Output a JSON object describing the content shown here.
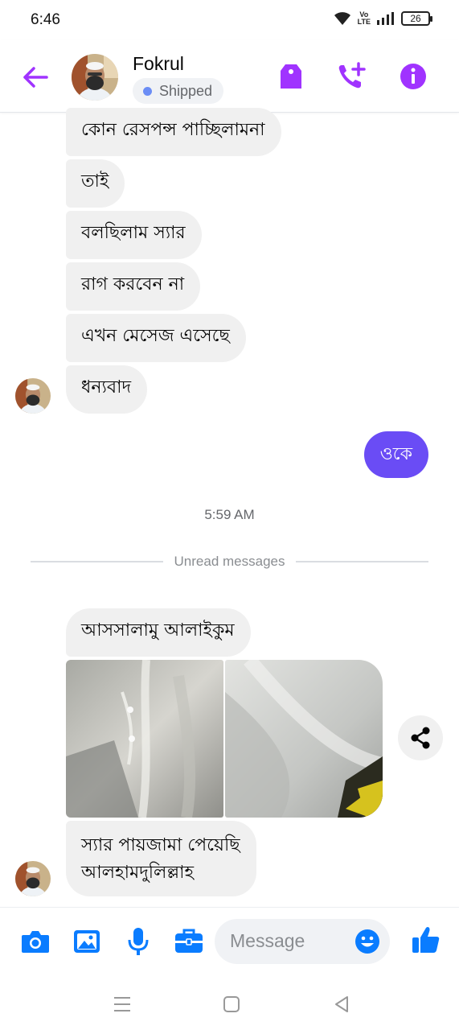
{
  "status_bar": {
    "time": "6:46",
    "volte_line1": "Vo",
    "volte_line2": "LTE",
    "battery": "26"
  },
  "header": {
    "name": "Fokrul",
    "label_chip": "Shipped",
    "accent_color": "#a033ff",
    "icons": [
      "back-arrow-icon",
      "label-tag-icon",
      "add-call-icon",
      "info-icon"
    ]
  },
  "messages": {
    "incoming_first": [
      "কোন রেসপন্স পাচ্ছিলামনা",
      "তাই",
      "বলছিলাম স্যার",
      "রাগ করবেন না",
      "এখন মেসেজ এসেছে",
      "ধন্যবাদ"
    ],
    "outgoing": "ওকে",
    "outgoing_color": "#6a4cf5",
    "timestamp": "5:59 AM",
    "unread_divider": "Unread messages",
    "incoming_second": [
      "আসসালামু আলাইকুম"
    ],
    "incoming_last_line1": "স্যার পায়জামা পেয়েছি",
    "incoming_last_line2": "আলহামদুলিল্লাহ"
  },
  "composer": {
    "placeholder": "Message",
    "accent_color": "#0a7cff",
    "icons": [
      "camera-icon",
      "gallery-icon",
      "microphone-icon",
      "briefcase-icon",
      "emoji-icon",
      "thumbs-up-icon"
    ]
  },
  "nav_bar": {
    "icons": [
      "menu-icon",
      "home-icon",
      "back-icon"
    ]
  }
}
